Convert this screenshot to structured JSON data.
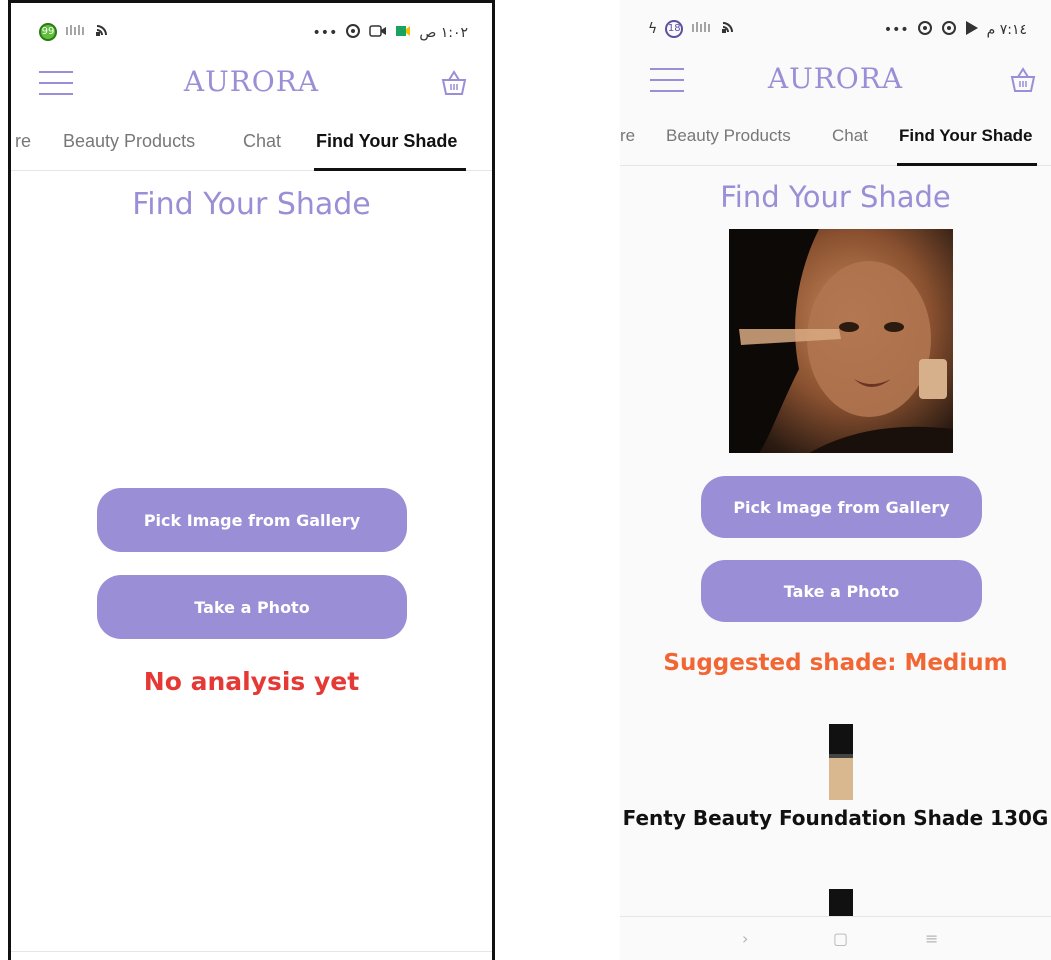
{
  "left": {
    "status": {
      "time": "١:٠٢ ص",
      "battery_badge": "99",
      "menu_dots": "•••"
    },
    "app_title": "AURORA",
    "tabs": [
      {
        "label": "re"
      },
      {
        "label": "Beauty Products"
      },
      {
        "label": "Chat"
      },
      {
        "label": "Find Your Shade"
      }
    ],
    "page_title": "Find Your Shade",
    "buttons": {
      "gallery": "Pick Image from Gallery",
      "photo": "Take a Photo"
    },
    "result_text": "No analysis yet",
    "colors": {
      "accent": "#9a8fd6",
      "result": "#e53935"
    }
  },
  "right": {
    "status": {
      "time": "٧:١٤ م",
      "badge": "18",
      "sig": "ϟ",
      "menu_dots": "•••"
    },
    "app_title": "AURORA",
    "tabs": [
      {
        "label": "re"
      },
      {
        "label": "Beauty Products"
      },
      {
        "label": "Chat"
      },
      {
        "label": "Find Your Shade"
      }
    ],
    "page_title": "Find Your Shade",
    "buttons": {
      "gallery": "Pick Image from Gallery",
      "photo": "Take a Photo"
    },
    "result_text": "Suggested shade: Medium",
    "product_name": "Fenty Beauty Foundation Shade 130G",
    "nav": {
      "back": "›",
      "home": "▢",
      "recent": "≡"
    },
    "colors": {
      "accent": "#9a8fd6",
      "result": "#f26633"
    }
  }
}
